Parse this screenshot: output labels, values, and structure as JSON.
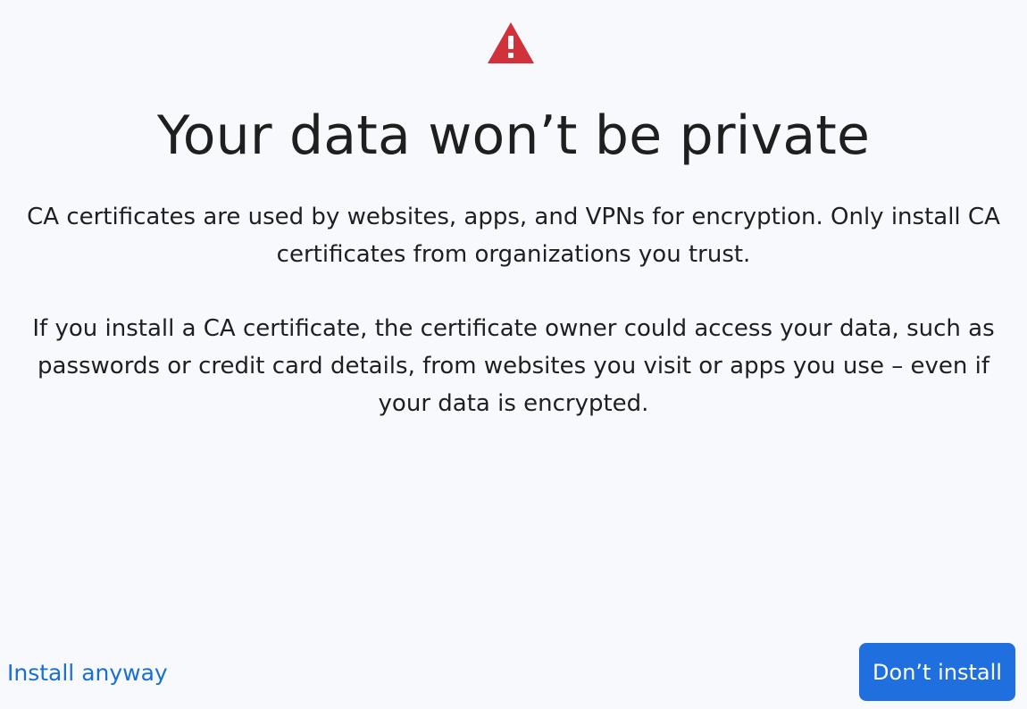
{
  "dialog": {
    "icon": "warning-triangle-icon",
    "accent_color": "#d0313a",
    "title": "Your data won’t be private",
    "paragraph_1": "CA certificates are used by websites, apps, and VPNs for encryption. Only install CA certificates from organizations you trust.",
    "paragraph_2": "If you install a CA certificate, the certificate owner could access your data, such as passwords or credit card details, from websites you visit or apps you use – even if your data is encrypted."
  },
  "actions": {
    "install_anyway_label": "Install anyway",
    "dont_install_label": "Don’t install",
    "primary_color": "#1f6fde",
    "link_color": "#1a6fd3"
  }
}
